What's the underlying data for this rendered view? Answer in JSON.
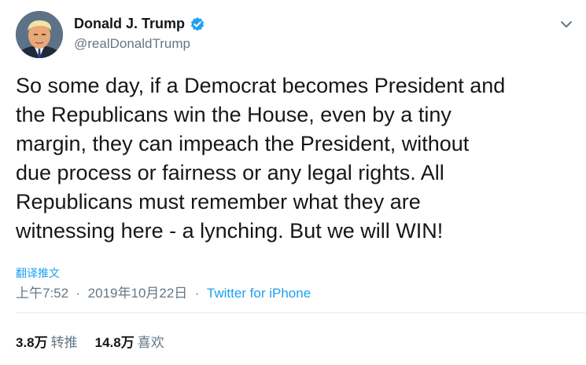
{
  "author": {
    "name": "Donald J. Trump",
    "handle": "@realDonaldTrump",
    "verified": true
  },
  "tweet": {
    "text_lines": [
      "So some day, if a Democrat becomes President and",
      "the Republicans win the House, even by a tiny",
      "margin, they can impeach the President, without",
      "due process or fairness or any legal rights. All",
      "Republicans must remember what they are",
      "witnessing here - a lynching. But we will WIN!"
    ],
    "translate_label": "翻译推文",
    "time": "上午7:52",
    "separator": "·",
    "date": "2019年10月22日",
    "source": "Twitter for iPhone"
  },
  "stats": {
    "retweets_count": "3.8万",
    "retweets_label": "转推",
    "likes_count": "14.8万",
    "likes_label": "喜欢"
  },
  "icons": {
    "verified": "verified-badge-icon",
    "menu": "chevron-down-icon"
  },
  "colors": {
    "accent": "#1da1f2",
    "text": "#14171a",
    "muted": "#657786"
  }
}
